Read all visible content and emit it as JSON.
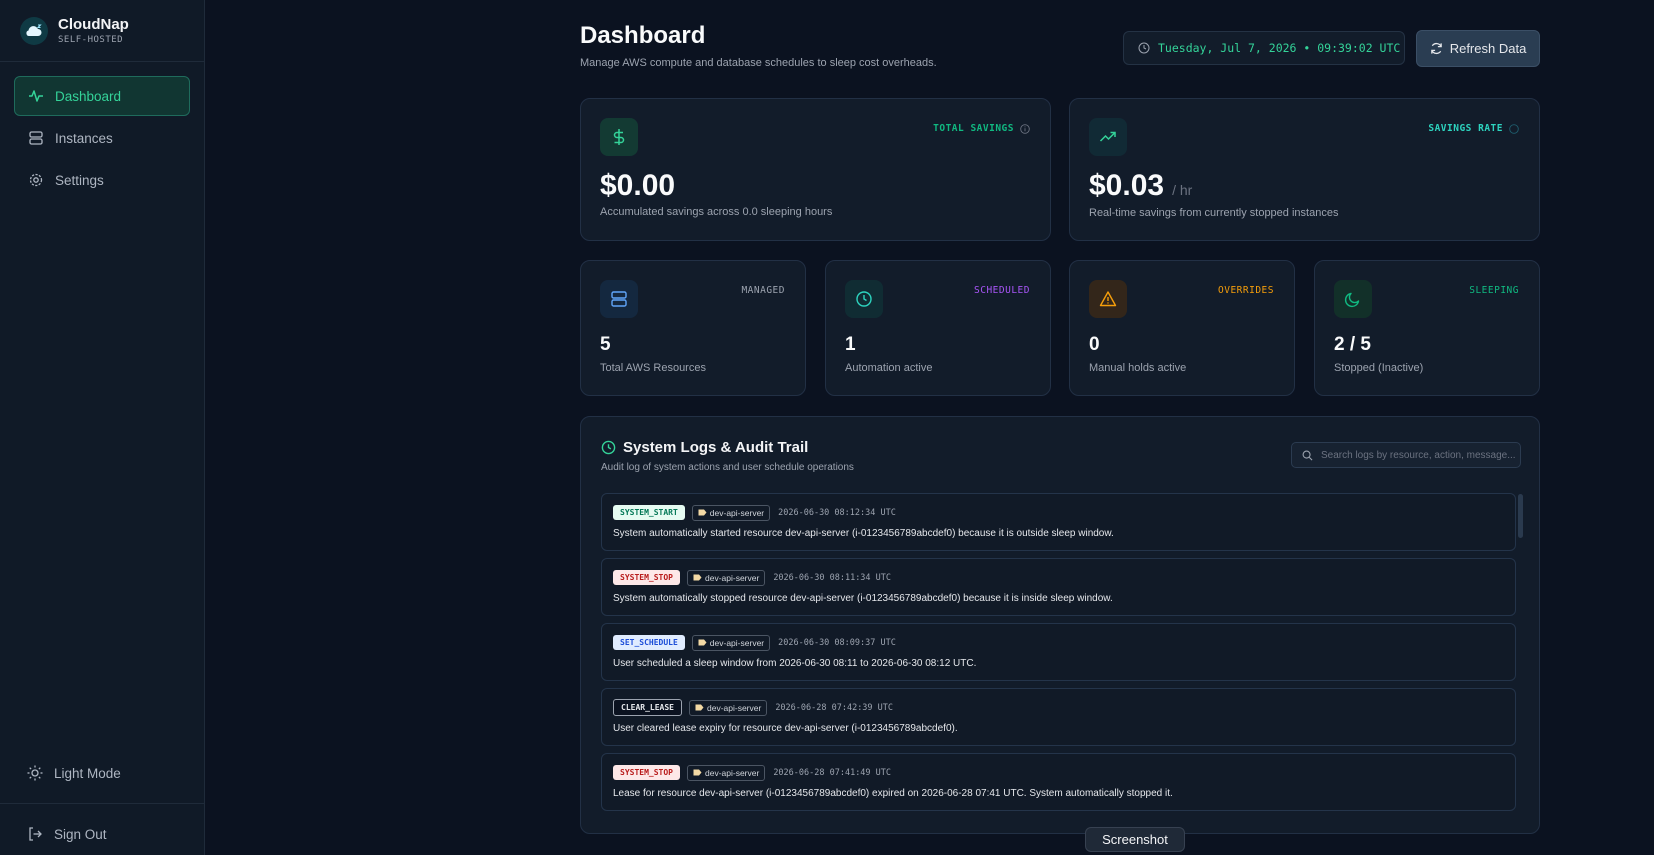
{
  "brand": {
    "name": "CloudNap",
    "subtitle": "SELF-HOSTED"
  },
  "sidebar": {
    "items": [
      {
        "label": "Dashboard",
        "icon": "activity-icon",
        "active": true
      },
      {
        "label": "Instances",
        "icon": "server-icon",
        "active": false
      },
      {
        "label": "Settings",
        "icon": "gear-icon",
        "active": false
      }
    ],
    "theme_toggle": "Light Mode",
    "sign_out": "Sign Out"
  },
  "header": {
    "title": "Dashboard",
    "subtitle": "Manage AWS compute and database schedules to sleep cost overheads.",
    "datetime": "Tuesday, Jul 7, 2026 • 09:39:02 UTC",
    "refresh_label": "Refresh Data"
  },
  "stats_top": [
    {
      "tag": "TOTAL SAVINGS",
      "value": "$0.00",
      "unit": "",
      "desc": "Accumulated savings across 0.0 sleeping hours",
      "icon": "dollar-icon",
      "accent": "#34d399"
    },
    {
      "tag": "SAVINGS RATE",
      "value": "$0.03",
      "unit": "/ hr",
      "desc": "Real-time savings from currently stopped instances",
      "icon": "trending-up-icon",
      "accent": "#34d399"
    }
  ],
  "stats_small": [
    {
      "tag": "MANAGED",
      "value": "5",
      "desc": "Total AWS Resources",
      "icon": "server-icon",
      "accent": "#9ca3af"
    },
    {
      "tag": "SCHEDULED",
      "value": "1",
      "desc": "Automation active",
      "icon": "clock-icon",
      "accent": "#a855f7"
    },
    {
      "tag": "OVERRIDES",
      "value": "0",
      "desc": "Manual holds active",
      "icon": "warning-icon",
      "accent": "#f59e0b"
    },
    {
      "tag": "SLEEPING",
      "value": "2 / 5",
      "desc": "Stopped (Inactive)",
      "icon": "moon-icon",
      "accent": "#10b981"
    }
  ],
  "logs": {
    "title": "System Logs & Audit Trail",
    "subtitle": "Audit log of system actions and user schedule operations",
    "search_placeholder": "Search logs by resource, action, message...",
    "entries": [
      {
        "action": "SYSTEM_START",
        "resource": "dev-api-server",
        "time": "2026-06-30 08:12:34 UTC",
        "message": "System automatically started resource dev-api-server (i-0123456789abcdef0) because it is outside sleep window."
      },
      {
        "action": "SYSTEM_STOP",
        "resource": "dev-api-server",
        "time": "2026-06-30 08:11:34 UTC",
        "message": "System automatically stopped resource dev-api-server (i-0123456789abcdef0) because it is inside sleep window."
      },
      {
        "action": "SET_SCHEDULE",
        "resource": "dev-api-server",
        "time": "2026-06-30 08:09:37 UTC",
        "message": "User scheduled a sleep window from 2026-06-30 08:11 to 2026-06-30 08:12 UTC."
      },
      {
        "action": "CLEAR_LEASE",
        "resource": "dev-api-server",
        "time": "2026-06-28 07:42:39 UTC",
        "message": "User cleared lease expiry for resource dev-api-server (i-0123456789abcdef0)."
      },
      {
        "action": "SYSTEM_STOP",
        "resource": "dev-api-server",
        "time": "2026-06-28 07:41:49 UTC",
        "message": "Lease for resource dev-api-server (i-0123456789abcdef0) expired on 2026-06-28 07:41 UTC. System automatically stopped it."
      }
    ]
  },
  "overlay": {
    "screenshot_label": "Screenshot"
  }
}
